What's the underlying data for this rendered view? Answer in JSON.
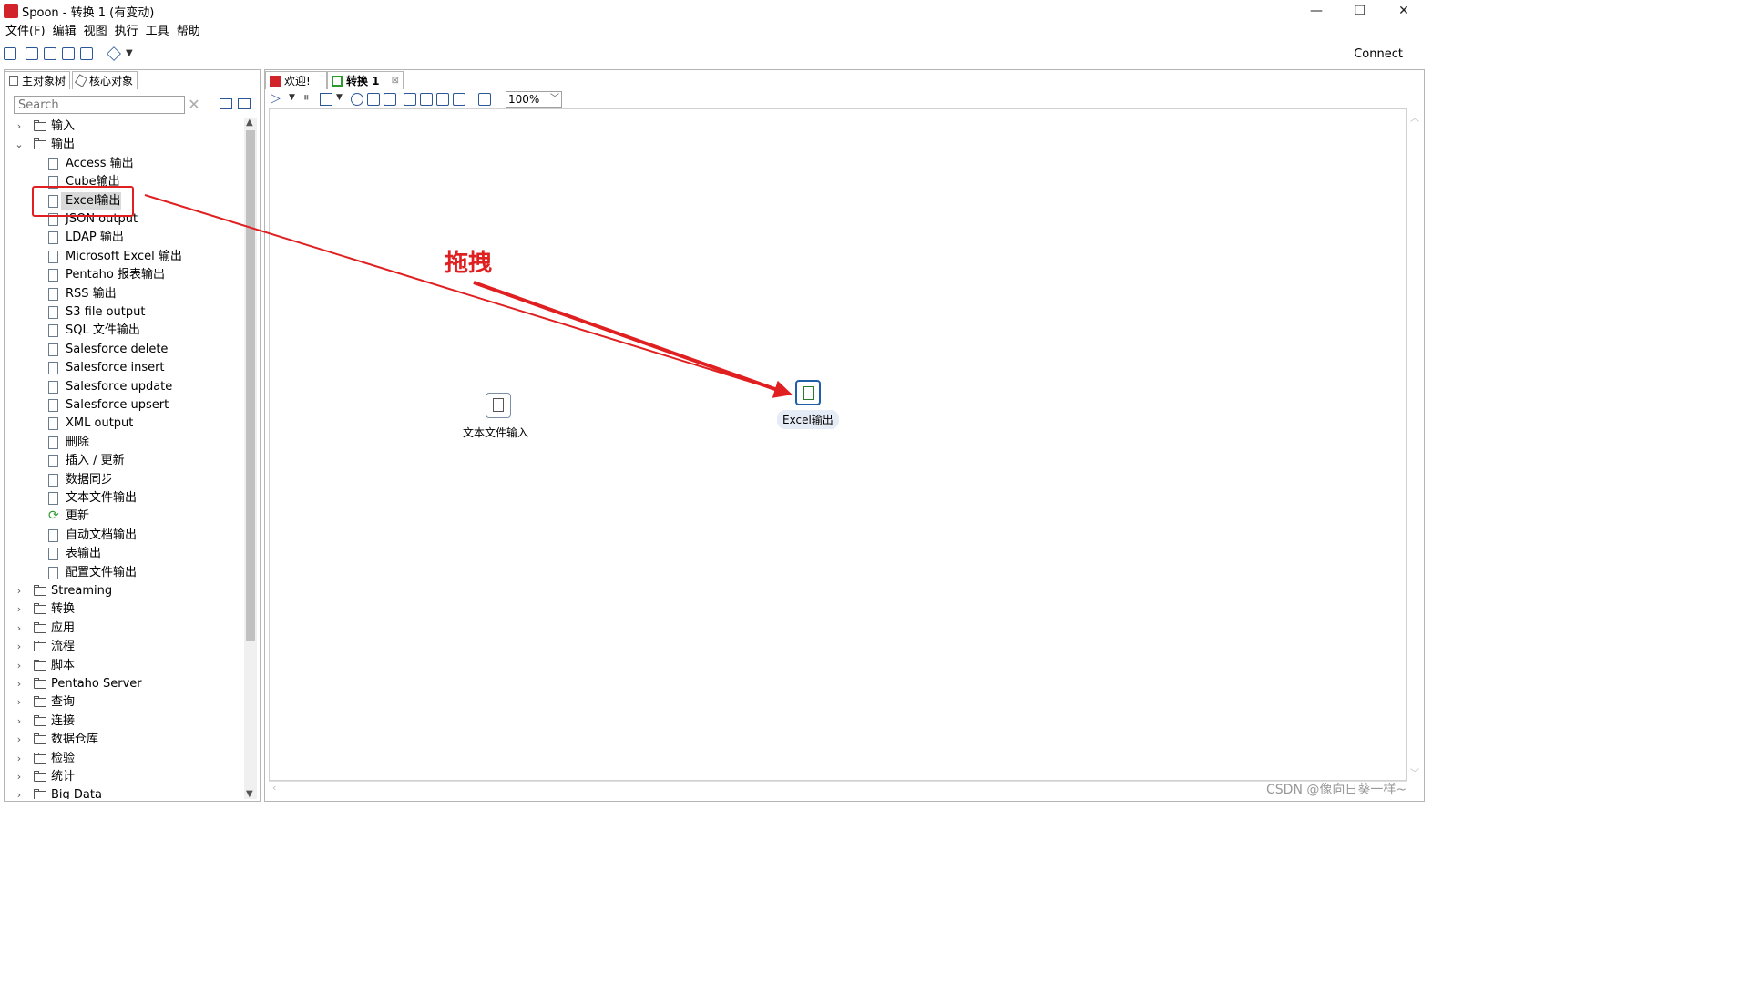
{
  "window": {
    "title": "Spoon - 转换 1 (有变动)",
    "minimize": "—",
    "restore": "❐",
    "close": "✕"
  },
  "menu": [
    "文件(F)",
    "编辑",
    "视图",
    "执行",
    "工具",
    "帮助"
  ],
  "toolbar": {
    "connect_label": "Connect"
  },
  "left_panel": {
    "tabs": [
      "主对象树",
      "核心对象"
    ],
    "search_placeholder": "Search",
    "tree": [
      {
        "label": "输入",
        "type": "folder",
        "expanded": false
      },
      {
        "label": "输出",
        "type": "folder",
        "expanded": true
      },
      {
        "label": "Access 输出",
        "type": "leaf"
      },
      {
        "label": "Cube输出",
        "type": "leaf"
      },
      {
        "label": "Excel输出",
        "type": "leaf",
        "selected": true
      },
      {
        "label": "JSON output",
        "type": "leaf"
      },
      {
        "label": "LDAP 输出",
        "type": "leaf"
      },
      {
        "label": "Microsoft Excel 输出",
        "type": "leaf"
      },
      {
        "label": "Pentaho 报表输出",
        "type": "leaf"
      },
      {
        "label": "RSS 输出",
        "type": "leaf"
      },
      {
        "label": "S3 file output",
        "type": "leaf"
      },
      {
        "label": "SQL 文件输出",
        "type": "leaf"
      },
      {
        "label": "Salesforce delete",
        "type": "leaf"
      },
      {
        "label": "Salesforce insert",
        "type": "leaf"
      },
      {
        "label": "Salesforce update",
        "type": "leaf"
      },
      {
        "label": "Salesforce upsert",
        "type": "leaf"
      },
      {
        "label": "XML output",
        "type": "leaf"
      },
      {
        "label": "删除",
        "type": "leaf"
      },
      {
        "label": "插入 / 更新",
        "type": "leaf"
      },
      {
        "label": "数据同步",
        "type": "leaf"
      },
      {
        "label": "文本文件输出",
        "type": "leaf"
      },
      {
        "label": "更新",
        "type": "leaf",
        "icon": "refresh-icon"
      },
      {
        "label": "自动文档输出",
        "type": "leaf"
      },
      {
        "label": "表输出",
        "type": "leaf"
      },
      {
        "label": "配置文件输出",
        "type": "leaf"
      },
      {
        "label": "Streaming",
        "type": "folder",
        "expanded": false
      },
      {
        "label": "转换",
        "type": "folder",
        "expanded": false
      },
      {
        "label": "应用",
        "type": "folder",
        "expanded": false
      },
      {
        "label": "流程",
        "type": "folder",
        "expanded": false
      },
      {
        "label": "脚本",
        "type": "folder",
        "expanded": false
      },
      {
        "label": "Pentaho Server",
        "type": "folder",
        "expanded": false
      },
      {
        "label": "查询",
        "type": "folder",
        "expanded": false
      },
      {
        "label": "连接",
        "type": "folder",
        "expanded": false
      },
      {
        "label": "数据仓库",
        "type": "folder",
        "expanded": false
      },
      {
        "label": "检验",
        "type": "folder",
        "expanded": false
      },
      {
        "label": "统计",
        "type": "folder",
        "expanded": false
      },
      {
        "label": "Big Data",
        "type": "folder",
        "expanded": false
      }
    ]
  },
  "editor": {
    "tabs": [
      {
        "label": "欢迎!",
        "icon": "spoon-icon"
      },
      {
        "label": "转换 1",
        "icon": "transformation-icon",
        "active": true
      }
    ],
    "zoom": "100%",
    "steps": [
      {
        "label": "文本文件输入",
        "icon": "text-file-input-icon"
      },
      {
        "label": "Excel输出",
        "icon": "excel-output-icon",
        "selected": true
      }
    ]
  },
  "annotation": {
    "text": "拖拽",
    "color": "#e02020"
  },
  "watermark": "CSDN @像向日葵一样~",
  "colors": {
    "accent": "#2b5797",
    "annotation": "#e02020",
    "brand": "#d2232a"
  }
}
